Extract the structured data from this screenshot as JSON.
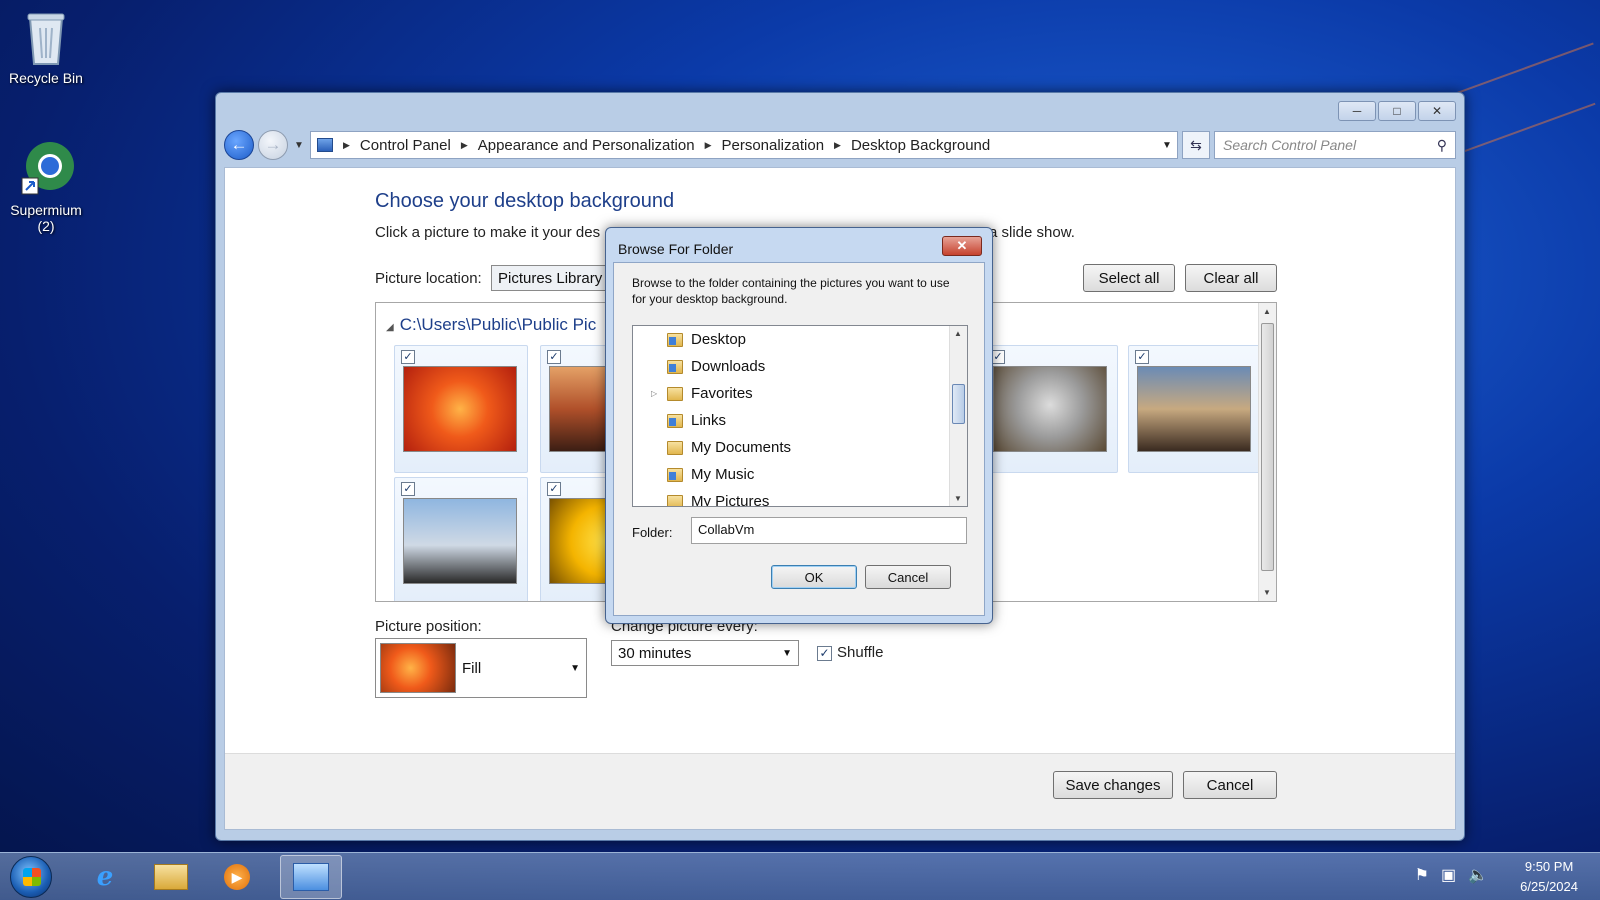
{
  "desktop": {
    "icons": [
      {
        "label": "Recycle Bin"
      },
      {
        "label": "Supermium\n(2)"
      }
    ]
  },
  "window": {
    "breadcrumb": [
      "Control Panel",
      "Appearance and Personalization",
      "Personalization",
      "Desktop Background"
    ],
    "search_placeholder": "Search Control Panel",
    "title": "Choose your desktop background",
    "description_left": "Click a picture to make it your des",
    "description_right": "a slide show.",
    "picture_location_label": "Picture location:",
    "picture_location_value": "Pictures Library",
    "select_all": "Select all",
    "clear_all": "Clear all",
    "gallery_path": "C:\\Users\\Public\\Public Pic",
    "picture_position_label": "Picture position:",
    "picture_position_value": "Fill",
    "change_every_label": "Change picture every:",
    "change_every_value": "30 minutes",
    "shuffle_label": "Shuffle",
    "save_changes": "Save changes",
    "cancel": "Cancel"
  },
  "dialog": {
    "title": "Browse For Folder",
    "message": "Browse to the folder containing the pictures you want to use for your desktop background.",
    "tree": [
      "Desktop",
      "Downloads",
      "Favorites",
      "Links",
      "My Documents",
      "My Music",
      "My Pictures"
    ],
    "folder_label": "Folder:",
    "folder_value": "CollabVm",
    "ok": "OK",
    "cancel": "Cancel"
  },
  "taskbar": {
    "time": "9:50 PM",
    "date": "6/25/2024"
  }
}
